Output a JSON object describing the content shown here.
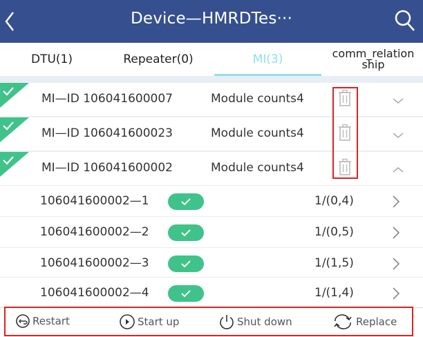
{
  "header": {
    "title": "Device—HMRDTes···"
  },
  "tabs": [
    {
      "label": "DTU(1)",
      "active": false
    },
    {
      "label": "Repeater(0)",
      "active": false
    },
    {
      "label": "MI(3)",
      "active": true
    },
    {
      "label_line1": "comm_relation",
      "label_line2": "ship",
      "active": false
    }
  ],
  "mi_rows": [
    {
      "id": "MI—ID 106041600007",
      "counts": "Module counts4",
      "expanded": false,
      "selected": true
    },
    {
      "id": "MI—ID 106041600023",
      "counts": "Module counts4",
      "expanded": false,
      "selected": true
    },
    {
      "id": "MI—ID 106041600002",
      "counts": "Module counts4",
      "expanded": true,
      "selected": true
    }
  ],
  "modules": [
    {
      "id": "106041600002—1",
      "position": "1/(0,4)",
      "status": "on"
    },
    {
      "id": "106041600002—2",
      "position": "1/(0,5)",
      "status": "on"
    },
    {
      "id": "106041600002—3",
      "position": "1/(1,5)",
      "status": "on"
    },
    {
      "id": "106041600002—4",
      "position": "1/(1,4)",
      "status": "on"
    }
  ],
  "footer": {
    "restart": "Restart",
    "start_up": "Start up",
    "shut_down": "Shut down",
    "replace": "Replace"
  },
  "colors": {
    "header_bg": "#36508f",
    "accent": "#8ee0f0",
    "check_green": "#3fc38a",
    "highlight_red": "#e02020"
  }
}
